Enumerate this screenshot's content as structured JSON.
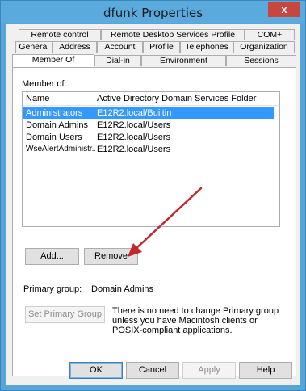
{
  "window": {
    "title": "dfunk Properties",
    "close_glyph": "x"
  },
  "tabs": {
    "row1": [
      "Remote control",
      "Remote Desktop Services Profile",
      "COM+"
    ],
    "row2": [
      "General",
      "Address",
      "Account",
      "Profile",
      "Telephones",
      "Organization"
    ],
    "row3": [
      "Member Of",
      "Dial-in",
      "Environment",
      "Sessions"
    ],
    "selected": "Member Of"
  },
  "member_of": {
    "label": "Member of:",
    "columns": [
      "Name",
      "Active Directory Domain Services Folder"
    ],
    "rows": [
      {
        "name": "Administrators",
        "folder": "E12R2.local/Builtin",
        "selected": true
      },
      {
        "name": "Domain Admins",
        "folder": "E12R2.local/Users",
        "selected": false
      },
      {
        "name": "Domain Users",
        "folder": "E12R2.local/Users",
        "selected": false
      },
      {
        "name": "WseAlertAdministr...",
        "folder": "E12R2.local/Users",
        "selected": false
      }
    ]
  },
  "actions": {
    "add_label": "Add...",
    "remove_label": "Remove"
  },
  "primary_group": {
    "label": "Primary group:",
    "value": "Domain Admins",
    "set_button_label": "Set Primary Group",
    "note": "There is no need to change Primary group unless you have Macintosh clients or POSIX-compliant applications."
  },
  "dialog_buttons": {
    "ok": "OK",
    "cancel": "Cancel",
    "apply": "Apply",
    "help": "Help"
  },
  "colors": {
    "title_bar": "#5aaadd",
    "close_button": "#c7463f",
    "selection": "#3399ff",
    "annotation_arrow": "#c0282d"
  },
  "icons": {
    "close": "close-icon",
    "annotation": "red-arrow-icon"
  }
}
